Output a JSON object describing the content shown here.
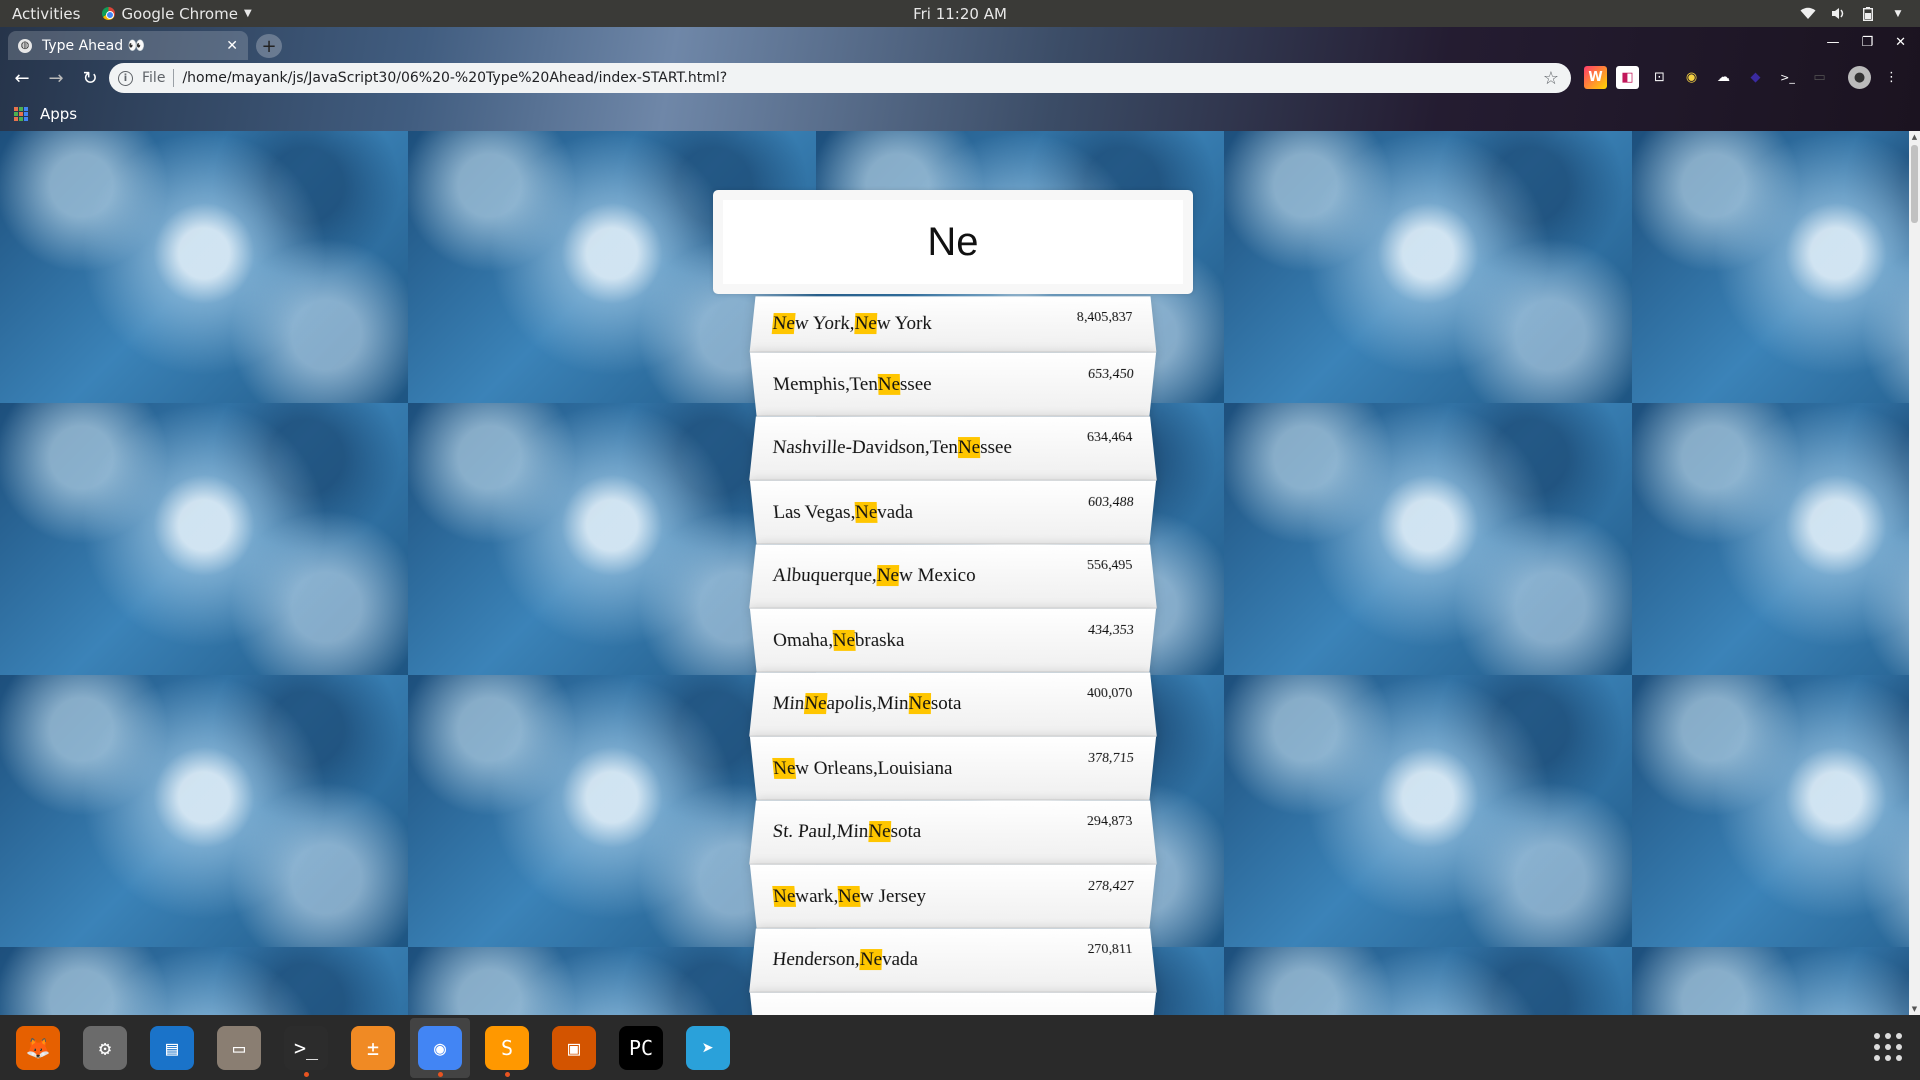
{
  "topbar": {
    "activities": "Activities",
    "app_name": "Google Chrome",
    "clock": "Fri 11:20 AM"
  },
  "browser": {
    "tab_title": "Type Ahead 👀",
    "address_scheme": "File",
    "address_url": "/home/mayank/js/JavaScript30/06%20-%20Type%20Ahead/index-START.html?",
    "bookmarks_apps_label": "Apps",
    "extensions": [
      "W",
      "◧",
      "⊡",
      "◉",
      "☁",
      "◆",
      ">_",
      "▭"
    ]
  },
  "search": {
    "value": "Ne"
  },
  "suggestions": [
    {
      "parts": [
        {
          "t": "Ne",
          "h": true
        },
        {
          "t": "w York,",
          "h": false
        },
        {
          "t": "Ne",
          "h": true
        },
        {
          "t": "w York",
          "h": false
        }
      ],
      "population": "8,405,837"
    },
    {
      "parts": [
        {
          "t": "Memphis,Ten",
          "h": false
        },
        {
          "t": "Ne",
          "h": true
        },
        {
          "t": "ssee",
          "h": false
        }
      ],
      "population": "653,450"
    },
    {
      "parts": [
        {
          "t": "Nashville-Davidson,Ten",
          "h": false
        },
        {
          "t": "Ne",
          "h": true
        },
        {
          "t": "ssee",
          "h": false
        }
      ],
      "population": "634,464"
    },
    {
      "parts": [
        {
          "t": "Las Vegas,",
          "h": false
        },
        {
          "t": "Ne",
          "h": true
        },
        {
          "t": "vada",
          "h": false
        }
      ],
      "population": "603,488"
    },
    {
      "parts": [
        {
          "t": "Albuquerque,",
          "h": false
        },
        {
          "t": "Ne",
          "h": true
        },
        {
          "t": "w Mexico",
          "h": false
        }
      ],
      "population": "556,495"
    },
    {
      "parts": [
        {
          "t": "Omaha,",
          "h": false
        },
        {
          "t": "Ne",
          "h": true
        },
        {
          "t": "braska",
          "h": false
        }
      ],
      "population": "434,353"
    },
    {
      "parts": [
        {
          "t": "Min",
          "h": false
        },
        {
          "t": "Ne",
          "h": true
        },
        {
          "t": "apolis,Min",
          "h": false
        },
        {
          "t": "Ne",
          "h": true
        },
        {
          "t": "sota",
          "h": false
        }
      ],
      "population": "400,070"
    },
    {
      "parts": [
        {
          "t": "Ne",
          "h": true
        },
        {
          "t": "w Orleans,Louisiana",
          "h": false
        }
      ],
      "population": "378,715"
    },
    {
      "parts": [
        {
          "t": "St. Paul,Min",
          "h": false
        },
        {
          "t": "Ne",
          "h": true
        },
        {
          "t": "sota",
          "h": false
        }
      ],
      "population": "294,873"
    },
    {
      "parts": [
        {
          "t": "Ne",
          "h": true
        },
        {
          "t": "wark,",
          "h": false
        },
        {
          "t": "Ne",
          "h": true
        },
        {
          "t": "w Jersey",
          "h": false
        }
      ],
      "population": "278,427"
    },
    {
      "parts": [
        {
          "t": "Henderson,",
          "h": false
        },
        {
          "t": "Ne",
          "h": true
        },
        {
          "t": "vada",
          "h": false
        }
      ],
      "population": "270,811"
    },
    {
      "parts": [
        {
          "t": "",
          "h": false
        }
      ],
      "population": ""
    }
  ],
  "dock": [
    {
      "name": "firefox-icon",
      "glyph": "🦊",
      "color": "#e66000",
      "running": false
    },
    {
      "name": "settings-icon",
      "glyph": "⚙",
      "color": "#6b6b6b",
      "running": false
    },
    {
      "name": "writer-icon",
      "glyph": "▤",
      "color": "#1a73c9",
      "running": false
    },
    {
      "name": "files-icon",
      "glyph": "▭",
      "color": "#8a7e72",
      "running": false
    },
    {
      "name": "terminal-icon",
      "glyph": ">_",
      "color": "#2c2c2c",
      "running": true
    },
    {
      "name": "calculator-icon",
      "glyph": "±",
      "color": "#f08a24",
      "running": false
    },
    {
      "name": "chrome-icon",
      "glyph": "◉",
      "color": "#4285f4",
      "running": true
    },
    {
      "name": "sublime-icon",
      "glyph": "S",
      "color": "#ff9800",
      "running": true
    },
    {
      "name": "impress-icon",
      "glyph": "▣",
      "color": "#d35400",
      "running": false
    },
    {
      "name": "pycharm-icon",
      "glyph": "PC",
      "color": "#000000",
      "running": false
    },
    {
      "name": "telegram-icon",
      "glyph": "➤",
      "color": "#2aa1da",
      "running": false
    }
  ]
}
